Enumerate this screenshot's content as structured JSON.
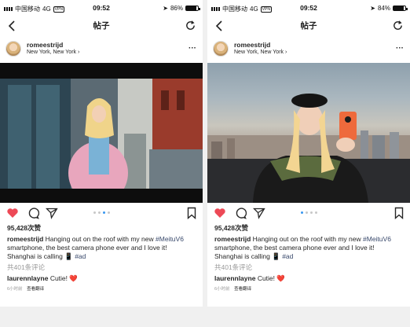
{
  "status_bar": {
    "left": {
      "carrier": "中国移动",
      "network": "4G",
      "vpn": "VPN",
      "time": "09:52",
      "battery_text": "86%",
      "battery_level": 0.86
    },
    "right": {
      "carrier": "中国移动",
      "network": "4G",
      "vpn": "VPN",
      "time": "09:52",
      "battery_text": "84%",
      "battery_level": 0.84
    }
  },
  "nav": {
    "title": "帖子",
    "icons": [
      "back-arrow-icon",
      "refresh-icon"
    ]
  },
  "posts": [
    {
      "username": "romeestrijd",
      "location": "New York, New York",
      "likes": "95,428次赞",
      "caption_user": "romeestrijd",
      "caption_text_1": "Hanging out on the roof with my new",
      "caption_hashtag_1": "#MeituV6",
      "caption_text_2": "smartphone, the best camera phone ever and I love it! Shanghai is calling 📱",
      "caption_hashtag_2": "#ad",
      "view_comments": "共401条评论",
      "comment_user": "laurennlayne",
      "comment_text": "Cutie!",
      "comment_emoji": "❤️",
      "time_ago": "6小时前",
      "translate": "查看翻译",
      "carousel_count": 4,
      "carousel_active": 2
    },
    {
      "username": "romeestrijd",
      "location": "New York, New York",
      "likes": "95,428次赞",
      "caption_user": "romeestrijd",
      "caption_text_1": "Hanging out on the roof with my new",
      "caption_hashtag_1": "#MeituV6",
      "caption_text_2": "smartphone, the best camera phone ever and I love it! Shanghai is calling 📱",
      "caption_hashtag_2": "#ad",
      "view_comments": "共401条评论",
      "comment_user": "laurennlayne",
      "comment_text": "Cutie!",
      "comment_emoji": "❤️",
      "time_ago": "6小时前",
      "translate": "查看翻译",
      "carousel_count": 4,
      "carousel_active": 0
    }
  ],
  "colors": {
    "like_red": "#ed4956",
    "carousel_blue": "#3897f0",
    "hashtag": "#38486b"
  }
}
